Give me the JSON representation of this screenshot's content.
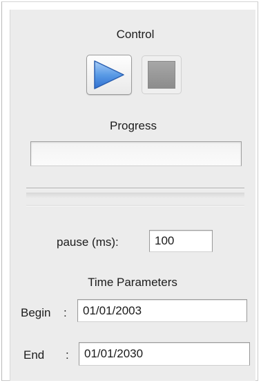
{
  "control": {
    "heading": "Control",
    "play_icon": "play-icon",
    "stop_icon": "stop-icon"
  },
  "progress": {
    "heading": "Progress",
    "value_percent": 0
  },
  "pause": {
    "label": "pause (ms):",
    "value": "100"
  },
  "time_parameters": {
    "heading": "Time Parameters",
    "begin": {
      "label": "Begin",
      "separator": ":",
      "value": "01/01/2003"
    },
    "end": {
      "label": "End",
      "separator": ":",
      "value": "01/01/2030"
    }
  },
  "colors": {
    "play_triangle": "#2f7de1",
    "panel_background": "#ececec"
  }
}
